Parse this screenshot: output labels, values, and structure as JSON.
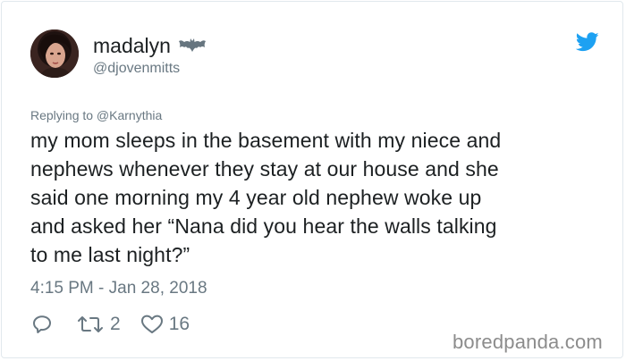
{
  "author": {
    "display_name": "madalyn",
    "emoji_icon": "bat-emoji",
    "handle": "@djovenmitts"
  },
  "platform_icon": "twitter-bird-icon",
  "brand_color": "#1da1f2",
  "tweet": {
    "reply_context": "Replying to @Karnythia",
    "text_lines": [
      "my mom sleeps in the basement with my niece and",
      "nephews whenever they stay at our house and she",
      "said one morning my 4 year old nephew woke up",
      "and asked her “Nana did you hear the walls talking",
      "to me last night?”"
    ],
    "timestamp": "4:15 PM - Jan 28, 2018"
  },
  "actions": {
    "reply_icon": "reply-icon",
    "retweet_icon": "retweet-icon",
    "retweet_count": "2",
    "like_icon": "heart-icon",
    "like_count": "16"
  },
  "watermark": "boredpanda.com"
}
